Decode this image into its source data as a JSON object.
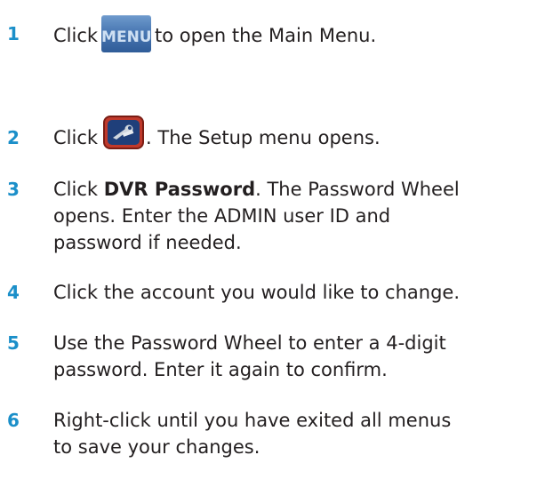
{
  "steps": [
    {
      "number": "1",
      "pre": "Click",
      "icon_label": "MENU",
      "icon_name": "menu-icon",
      "post": "to open the Main Menu."
    },
    {
      "number": "2",
      "pre": "Click",
      "icon_name": "setup-icon",
      "post": ". The Setup menu opens."
    },
    {
      "number": "3",
      "pre": "Click",
      "bold": "DVR Password",
      "post_line1": ". The Password Wheel",
      "line2": "opens. Enter the ADMIN user ID and",
      "line3": "password if needed."
    },
    {
      "number": "4",
      "line1": "Click the account you would like to change."
    },
    {
      "number": "5",
      "line1": "Use the Password Wheel to enter a 4-digit",
      "line2": "password. Enter it again to confirm."
    },
    {
      "number": "6",
      "line1": "Right-click until you have exited all menus",
      "line2": "to save your changes."
    }
  ],
  "colors": {
    "step_number": "#1b8fc9",
    "text": "#231f20",
    "menu_button": "#4a78b3",
    "setup_button": "#c0392b"
  }
}
